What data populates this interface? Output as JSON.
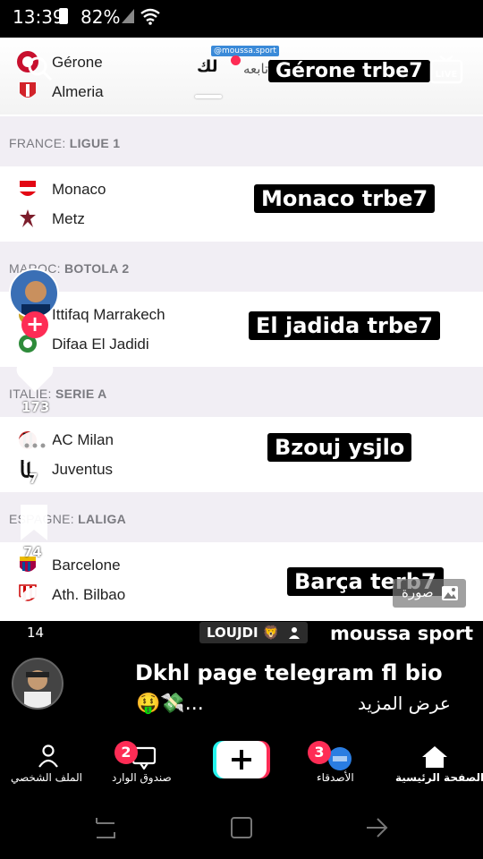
{
  "status": {
    "time": "13:39",
    "battery": "82%"
  },
  "video": {
    "watermark": "@moussa.sport",
    "tabs": {
      "for_you": "لك",
      "following": "أتابعه"
    },
    "matches": [
      {
        "home": "Gérone",
        "away": "Almeria",
        "caption": "Gérone trbe7"
      },
      {
        "home": "Monaco",
        "away": "Metz",
        "caption": "Monaco trbe7"
      },
      {
        "home": "Ittifaq Marrakech",
        "away": "Difaa El Jadidi",
        "caption": "El jadida trbe7"
      },
      {
        "home": "AC Milan",
        "away": "Juventus",
        "caption": "Bzouj ysjlo"
      },
      {
        "home": "Barcelone",
        "away": "Ath. Bilbao",
        "caption": "Barça terb7"
      }
    ],
    "leagues": [
      {
        "country": "FRANCE:",
        "name": "LIGUE 1"
      },
      {
        "country": "MAROC:",
        "name": "BOTOLA 2"
      },
      {
        "country": "ITALIE:",
        "name": "SERIE A"
      },
      {
        "country": "ESPAGNE:",
        "name": "LALIGA"
      }
    ],
    "side": {
      "likes": "173",
      "comments": "7",
      "saves": "74"
    },
    "photo_chip": "صورة"
  },
  "info": {
    "count": "14",
    "tag": "LOUJDI 🦁",
    "username": "moussa sport",
    "description": "Dkhl page telegram fl bio",
    "emojis": "🤑💸...",
    "see_more": "عرض المزيد"
  },
  "nav": {
    "profile": "الملف الشخصي",
    "inbox": "صندوق الوارد",
    "inbox_badge": "2",
    "friends": "الأصدقاء",
    "friends_badge": "3",
    "home": "الصفحة الرئيسية"
  },
  "colors": {
    "accent": "#fe2c55",
    "cyan": "#25f4ee",
    "league_bg": "#f1eef4"
  }
}
